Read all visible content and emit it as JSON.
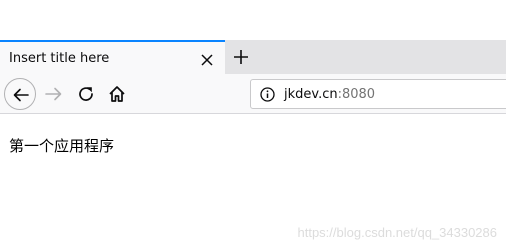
{
  "tab": {
    "title": "Insert title here"
  },
  "url": {
    "host": "jkdev.cn",
    "port": ":8080"
  },
  "page": {
    "text": "第一个应用程序"
  },
  "watermark": "https://blog.csdn.net/qq_34330286",
  "colors": {
    "tab_accent": "#0a84ff",
    "tab_strip": "#e3e3e5",
    "toolbar": "#f9f9fa"
  },
  "icons": {
    "close": "close-icon",
    "new_tab": "plus-icon",
    "back": "back-arrow-icon",
    "forward": "forward-arrow-icon",
    "reload": "reload-icon",
    "home": "home-icon",
    "site_info": "info-icon"
  }
}
